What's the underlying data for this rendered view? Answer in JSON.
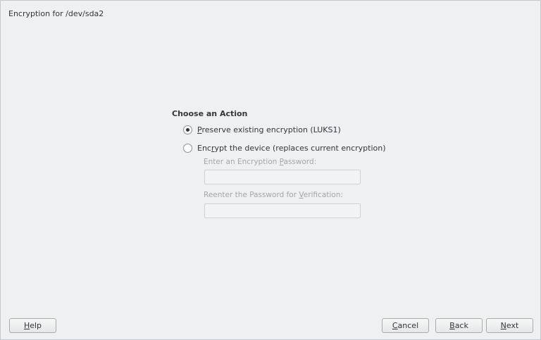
{
  "dialog": {
    "title": "Encryption for /dev/sda2"
  },
  "action_group": {
    "title": "Choose an Action",
    "options": [
      {
        "label_pre": "",
        "label_mnemonic": "P",
        "label_post": "reserve existing encryption (LUKS1)",
        "checked": true
      },
      {
        "label_pre": "Enc",
        "label_mnemonic": "r",
        "label_post": "ypt the device (replaces current encryption)",
        "checked": false
      }
    ]
  },
  "password": {
    "label_pre": "Enter an Encryption ",
    "label_mnemonic": "P",
    "label_post": "assword:",
    "value": "",
    "enabled": false
  },
  "verify": {
    "label_pre": "Reenter the Password for ",
    "label_mnemonic": "V",
    "label_post": "erification:",
    "value": "",
    "enabled": false
  },
  "buttons": {
    "help": {
      "mnemonic": "H",
      "rest": "elp"
    },
    "cancel": {
      "mnemonic": "C",
      "rest": "ancel"
    },
    "back": {
      "mnemonic": "B",
      "rest": "ack"
    },
    "next": {
      "mnemonic": "N",
      "rest": "ext"
    }
  }
}
